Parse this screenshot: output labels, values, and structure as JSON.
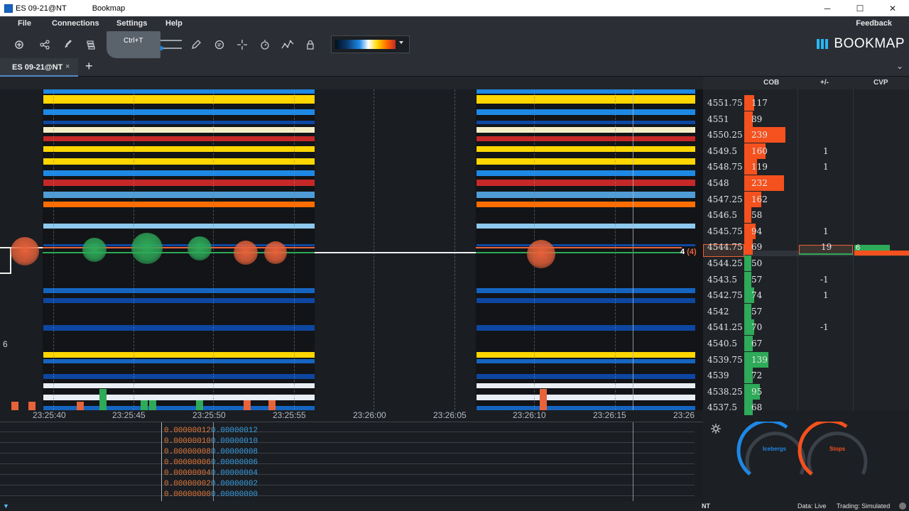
{
  "window": {
    "title": "ES 09-21@NT",
    "app": "Bookmap",
    "minimize": "─",
    "maximize": "☐",
    "close": "✕"
  },
  "menu": {
    "file": "File",
    "connections": "Connections",
    "settings": "Settings",
    "help": "Help",
    "feedback": "Feedback"
  },
  "toolbar": {
    "tooltip": "Ctrl+T",
    "logo": "BOOKMAP"
  },
  "tabs": {
    "active": "ES 09-21@NT",
    "close": "×",
    "add": "+",
    "menu": "⌄"
  },
  "panel": {
    "cob": "COB",
    "plusminus": "+/-",
    "cvp": "CVP"
  },
  "time_axis": [
    "23:25:40",
    "23:25:45",
    "23:25:50",
    "23:25:55",
    "23:26:00",
    "23:26:05",
    "23:26:10",
    "23:26:15",
    "23:26"
  ],
  "price_ladder": [
    {
      "price": "4551.75",
      "cob": "117",
      "pm": ""
    },
    {
      "price": "4551",
      "cob": "89",
      "pm": ""
    },
    {
      "price": "4550.25",
      "cob": "239",
      "pm": ""
    },
    {
      "price": "4549.5",
      "cob": "160",
      "pm": "1"
    },
    {
      "price": "4548.75",
      "cob": "119",
      "pm": "1"
    },
    {
      "price": "4548",
      "cob": "232",
      "pm": ""
    },
    {
      "price": "4547.25",
      "cob": "162",
      "pm": ""
    },
    {
      "price": "4546.5",
      "cob": "58",
      "pm": ""
    },
    {
      "price": "4545.75",
      "cob": "94",
      "pm": "1"
    },
    {
      "price": "4544.75",
      "cob": "69",
      "pm": "19"
    },
    {
      "price": "4544.25",
      "cob": "50",
      "pm": ""
    },
    {
      "price": "4543.5",
      "cob": "57",
      "pm": "-1"
    },
    {
      "price": "4542.75",
      "cob": "74",
      "pm": "1"
    },
    {
      "price": "4542",
      "cob": "57",
      "pm": ""
    },
    {
      "price": "4541.25",
      "cob": "70",
      "pm": "-1"
    },
    {
      "price": "4540.5",
      "cob": "67",
      "pm": ""
    },
    {
      "price": "4539.75",
      "cob": "139",
      "pm": ""
    },
    {
      "price": "4539",
      "cob": "72",
      "pm": ""
    },
    {
      "price": "4538.25",
      "cob": "95",
      "pm": ""
    },
    {
      "price": "4537.5",
      "cob": "68",
      "pm": ""
    }
  ],
  "last_trade": {
    "size": "4",
    "paren": "(4)",
    "cvp": "6"
  },
  "left_marker": "6",
  "indicator_values": [
    {
      "a": "0.00000012",
      "b": "0.00000012"
    },
    {
      "a": "0.00000010",
      "b": "0.00000010"
    },
    {
      "a": "0.00000008",
      "b": "0.00000008"
    },
    {
      "a": "0.00000006",
      "b": "0.00000006"
    },
    {
      "a": "0.00000004",
      "b": "0.00000004"
    },
    {
      "a": "0.00000002",
      "b": "0.00000002"
    },
    {
      "a": "0.00000000",
      "b": "0.00000000"
    }
  ],
  "gauges": {
    "icebergs": "Icebergs",
    "stops": "Stops"
  },
  "status": {
    "provider": "NT",
    "data": "Data: Live",
    "trading": "Trading: Simulated"
  }
}
